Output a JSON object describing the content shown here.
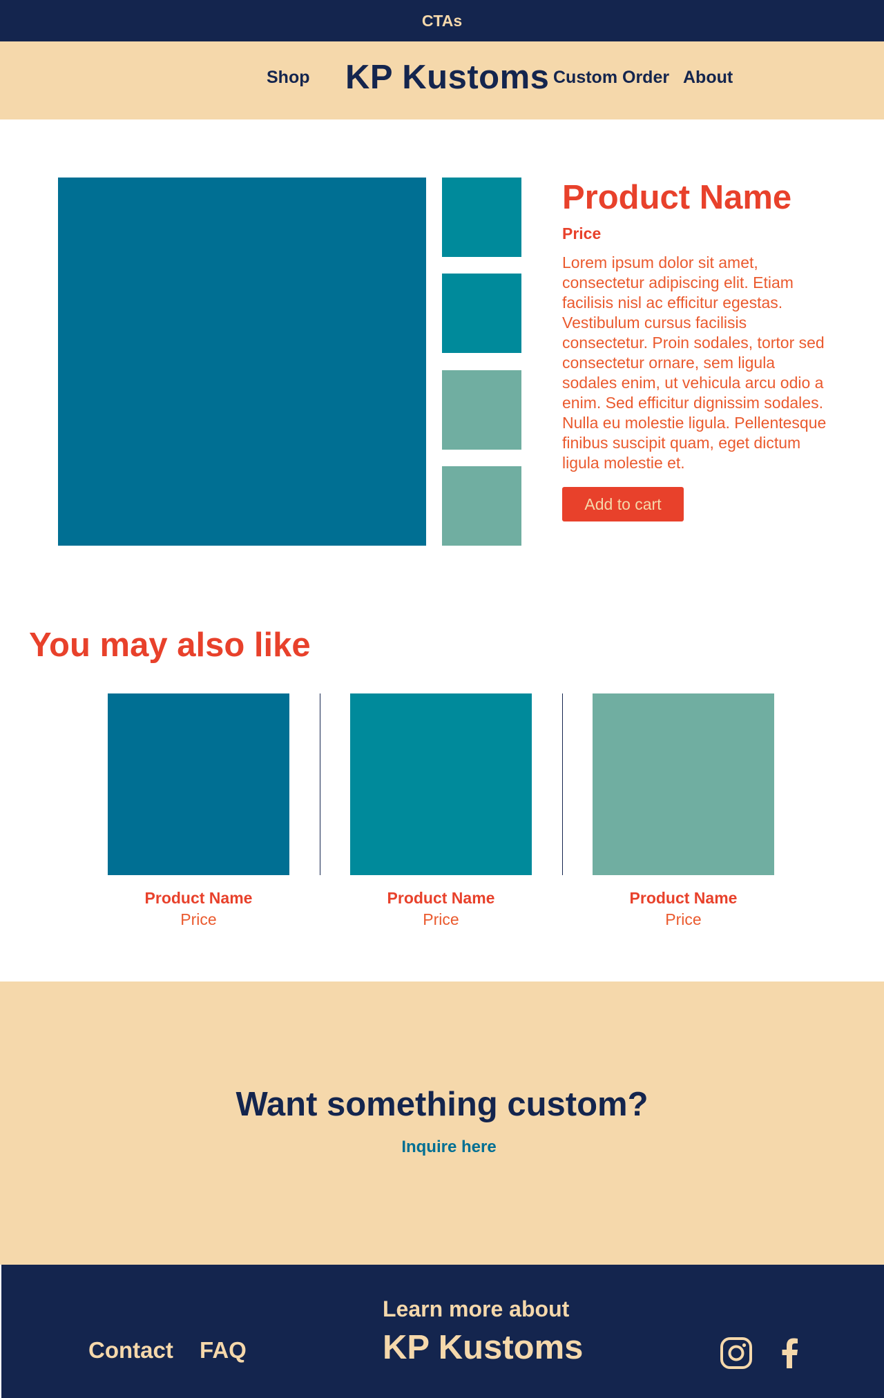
{
  "cta_bar": {
    "text": "CTAs"
  },
  "header": {
    "brand": "KP Kustoms",
    "nav": {
      "shop": "Shop",
      "custom_order": "Custom Order",
      "about": "About"
    }
  },
  "product": {
    "name": "Product Name",
    "price": "Price",
    "description": "Lorem ipsum dolor sit amet, consectetur adipiscing elit. Etiam facilisis nisl ac efficitur egestas. Vestibulum cursus facilisis consectetur. Proin sodales, tortor sed consectetur ornare, sem ligula sodales enim, ut vehicula arcu odio a enim. Sed efficitur dignissim sodales. Nulla eu molestie ligula. Pellentesque finibus suscipit quam, eget dictum ligula molestie et.",
    "add_to_cart": "Add to cart"
  },
  "related": {
    "heading": "You may also like",
    "items": [
      {
        "name": "Product Name",
        "price": "Price",
        "color": "#006f93"
      },
      {
        "name": "Product Name",
        "price": "Price",
        "color": "#008a9b"
      },
      {
        "name": "Product Name",
        "price": "Price",
        "color": "#70aea1"
      }
    ]
  },
  "custom": {
    "heading": "Want something custom?",
    "link": "Inquire here"
  },
  "footer": {
    "contact": "Contact",
    "faq": "FAQ",
    "learn_more": "Learn more about",
    "brand": "KP Kustoms",
    "social": [
      "instagram-icon",
      "facebook-icon"
    ]
  },
  "colors": {
    "navy": "#14254e",
    "cream": "#f5d8ab",
    "red": "#e8412b",
    "teal_dark": "#006f93",
    "teal": "#008a9b",
    "sage": "#70aea1"
  }
}
